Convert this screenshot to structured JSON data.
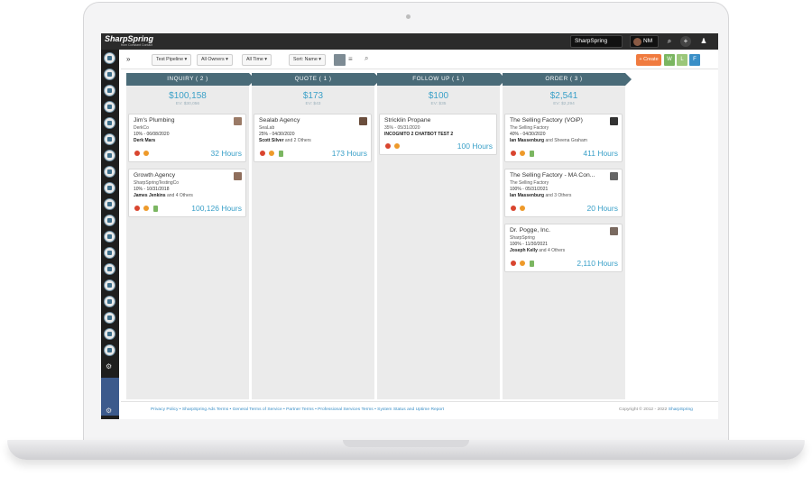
{
  "app": {
    "logo": "SharpSpring",
    "logo_sub": "from Constant Contact",
    "brand_button": "SharpSpring",
    "user_initials": "NM"
  },
  "toolbar": {
    "expand": "»",
    "pipeline": "Test Pipeline ▾",
    "owners": "All Owners ▾",
    "time": "All Time ▾",
    "sort": "Sort: Name ▾",
    "create": "+ Create",
    "w": "W",
    "l": "L",
    "f": "F"
  },
  "columns": [
    {
      "header": "INQUIRY ( 2 )",
      "total": "$100,158",
      "ev": "EV: $30,056",
      "cards": [
        {
          "title": "Jim's Plumbing",
          "company": "DerkCo",
          "line": "10% - 06/08/2020",
          "people": "Derk Mars",
          "others": "",
          "hours": "32 Hours",
          "avatar": "#9a7a66",
          "icons": [
            "red",
            "org"
          ]
        },
        {
          "title": "Growth Agency",
          "company": "SharpSpringTestingCo",
          "line": "10% - 10/31/2018",
          "people": "James Jenkins",
          "others": " and 4 Others",
          "hours": "100,126 Hours",
          "avatar": "#8f6e5c",
          "icons": [
            "red",
            "org",
            "grn"
          ]
        }
      ]
    },
    {
      "header": "QUOTE ( 1 )",
      "total": "$173",
      "ev": "EV: $43",
      "cards": [
        {
          "title": "Sealab Agency",
          "company": "SeaLab",
          "line": "25% - 04/30/2020",
          "people": "Scott Silver",
          "others": " and 2 Others",
          "hours": "173 Hours",
          "avatar": "#6b4e3d",
          "icons": [
            "red",
            "org",
            "grn"
          ]
        }
      ]
    },
    {
      "header": "FOLLOW UP ( 1 )",
      "total": "$100",
      "ev": "EV: $35",
      "cards": [
        {
          "title": "Stricklin Propane",
          "company": "",
          "line": "35% - 05/31/2020",
          "people": "INCOGNITO 2 CHATBOT TEST 2",
          "others": "",
          "hours": "100 Hours",
          "avatar": "",
          "icons": [
            "red",
            "org"
          ]
        }
      ]
    },
    {
      "header": "ORDER ( 3 )",
      "total": "$2,541",
      "ev": "EV: $2,294",
      "cards": [
        {
          "title": "The Selling Factory (VOiP)",
          "company": "The Selling Factory",
          "line": "40% - 04/30/2020",
          "people": "Ian Massenburg",
          "others": " and Sheena Graham",
          "hours": "411 Hours",
          "avatar": "#333333",
          "icons": [
            "red",
            "org",
            "grn"
          ]
        },
        {
          "title": "The Selling Factory - MA Con...",
          "company": "The Selling Factory",
          "line": "100% - 05/31/2021",
          "people": "Ian Massenburg",
          "others": " and 3 Others",
          "hours": "20 Hours",
          "avatar": "#666666",
          "icons": [
            "red",
            "org"
          ]
        },
        {
          "title": "Dr. Pogge, Inc.",
          "company": "SharpSpring",
          "line": "100% - 11/30/2021",
          "people": "Joseph Kelly",
          "others": " and 4 Others",
          "hours": "2,110 Hours",
          "avatar": "#7a6a60",
          "icons": [
            "red",
            "org",
            "grn"
          ]
        }
      ]
    }
  ],
  "footer": {
    "links": "Privacy Policy • SharpSpring Ads Terms • General Terms of Service • Partner Terms • Professional Services Terms • System Status and Uptime Report",
    "copyright": "Copyright © 2012 - 2022 ",
    "copyright_link": "SharpSpring"
  },
  "colors": {
    "header_bg": "#4a6b78",
    "accent": "#3aa0c8",
    "create": "#f07b3f",
    "w": "#7bb661",
    "l": "#9bc77a",
    "f": "#3a8fc7"
  }
}
